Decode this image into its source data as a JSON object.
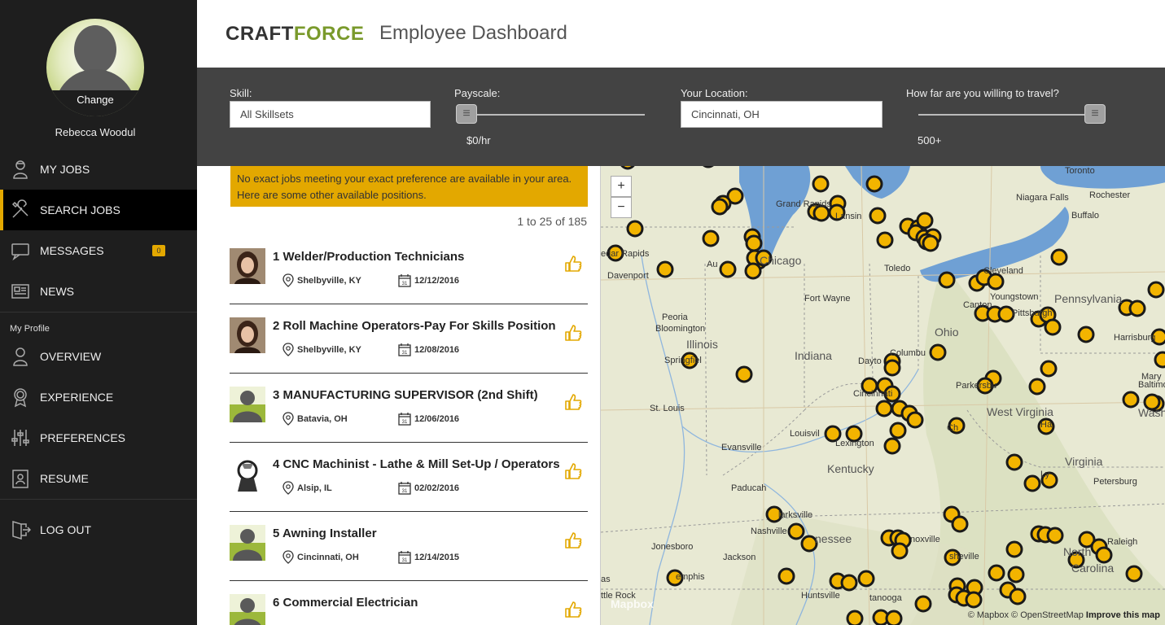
{
  "sidebar": {
    "avatar_change": "Change",
    "user_name": "Rebecca Woodul",
    "nav": [
      {
        "label": "MY JOBS",
        "icon": "worker-icon"
      },
      {
        "label": "SEARCH JOBS",
        "icon": "tools-icon",
        "active": true
      },
      {
        "label": "MESSAGES",
        "icon": "chat-icon",
        "badge": "0"
      },
      {
        "label": "NEWS",
        "icon": "newspaper-icon"
      }
    ],
    "profile_section": "My Profile",
    "profile_nav": [
      {
        "label": "OVERVIEW",
        "icon": "person-icon"
      },
      {
        "label": "EXPERIENCE",
        "icon": "award-icon"
      },
      {
        "label": "PREFERENCES",
        "icon": "sliders-icon"
      },
      {
        "label": "RESUME",
        "icon": "resume-icon"
      }
    ],
    "logout": "LOG OUT"
  },
  "header": {
    "logo_part1": "CRAFT",
    "logo_part2": "FORCE",
    "title": "Employee Dashboard"
  },
  "filters": {
    "skill_label": "Skill:",
    "skill_value": "All Skillsets",
    "payscale_label": "Payscale:",
    "payscale_value": "$0/hr",
    "payscale_level": 0,
    "location_label": "Your Location:",
    "location_value": "Cincinnati, OH",
    "travel_label": "How far are you willing to travel?",
    "travel_value": "500+",
    "travel_level": 1
  },
  "notice": {
    "line1": "No exact jobs meeting your exact preference are available in your area.",
    "line2": "Here are some other available positions."
  },
  "results_range": "1 to 25 of 185",
  "jobs": [
    {
      "title": "1 Welder/Production Technicians",
      "location": "Shelbyville, KY",
      "date": "12/12/2016",
      "thumb": "woman-photo"
    },
    {
      "title": "2 Roll Machine Operators-Pay For Skills Position",
      "location": "Shelbyville, KY",
      "date": "12/08/2016",
      "thumb": "woman-photo"
    },
    {
      "title": "3 MANUFACTURING SUPERVISOR (2nd Shift)",
      "location": "Batavia, OH",
      "date": "12/06/2016",
      "thumb": "default-avatar"
    },
    {
      "title": "4 CNC Machinist - Lathe & Mill Set-Up / Operators",
      "location": "Alsip, IL",
      "date": "02/02/2016",
      "thumb": "company-logo"
    },
    {
      "title": "5 Awning Installer",
      "location": "Cincinnati, OH",
      "date": "12/14/2015",
      "thumb": "default-avatar"
    },
    {
      "title": "6 Commercial Electrician",
      "location": "",
      "date": "",
      "thumb": "default-avatar"
    }
  ],
  "map": {
    "zoom_in": "+",
    "zoom_out": "−",
    "labels": {
      "toronto": "Toronto",
      "niagara": "Niagara Falls",
      "rochester": "Rochester",
      "buffalo": "Buffalo",
      "grand_rapids": "Grand Rapids",
      "lansing": "Lansin",
      "cedar_rapids": "edar Rapids",
      "davenport": "Davenport",
      "chicago": "Chicago",
      "aurora": "Au",
      "toledo": "Toledo",
      "cleveland": "Cleveland",
      "youngstown": "Youngstown",
      "canton": "Canton",
      "fort_wayne": "Fort Wayne",
      "peoria": "Peoria",
      "bloomington": "Bloomington",
      "pennsylvania": "Pennsylvania",
      "pittsburgh": "Pittsburgh",
      "harrisburg": "Harrisburg",
      "ohio": "Ohio",
      "illinois": "Illinois",
      "springfield": "Springfiel",
      "indiana": "Indiana",
      "dayton": "Dayto",
      "columbus": "Columbu",
      "cincinnati": "Cincinnati",
      "parkersburg": "Parkersbu",
      "maryland": "Mary",
      "baltimore": "Baltimo",
      "washington": "Washi",
      "st_louis": "St. Louis",
      "louisville": "Louisvil",
      "lexington": "Lexington",
      "west_virginia": "West Virginia",
      "charleston": "Ch",
      "harrisonburg": "Ha",
      "evansville": "Evansville",
      "kentucky": "Kentucky",
      "virginia": "Virginia",
      "lynchburg": "Ly",
      "petersburg": "Petersburg",
      "paducah": "Paducah",
      "clarksville": "larksville",
      "nashville": "Nashville",
      "tennessee": "nessee",
      "knoxville": "noxville",
      "asheville": "sheville",
      "raleigh": "Raleigh",
      "north_carolina": "North",
      "carolina": "Carolina",
      "jonesboro": "Jonesboro",
      "jackson": "Jackson",
      "memphis": "emphis",
      "chattanooga": "tanooga",
      "huntsville": "Huntsville",
      "little_rock": "ttle Rock",
      "arkansas": "as"
    },
    "mapbox_logo": "Mapbox",
    "attribution": "© Mapbox © OpenStreetMap",
    "improve": "Improve this map",
    "colors": {
      "marker_fill": "#f2b400",
      "marker_stroke": "#1a1a1a",
      "water": "#6fa0d4",
      "land": "#e9ead6"
    }
  }
}
